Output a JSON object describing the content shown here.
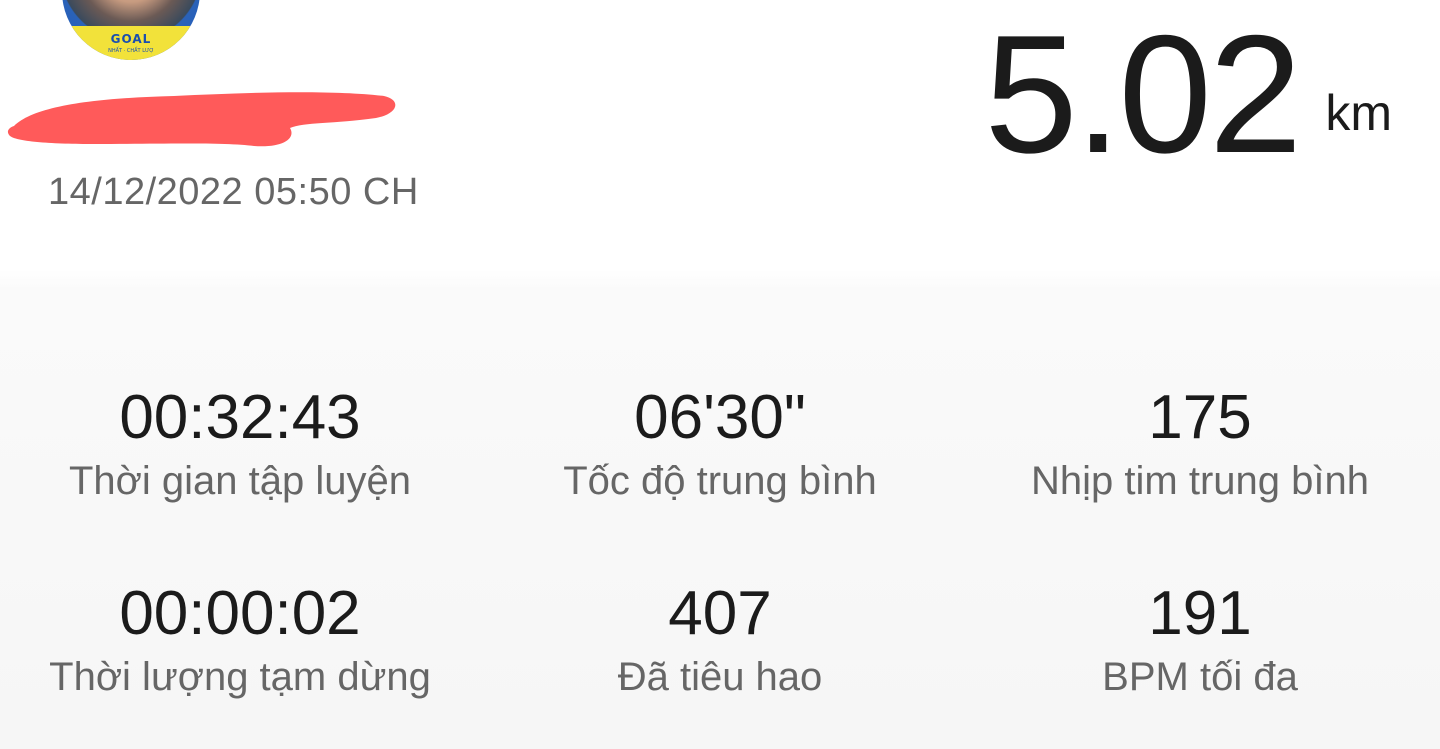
{
  "user": {
    "avatar_icon": "profile-avatar",
    "avatar_badge_text": "GOAL",
    "avatar_badge_subtext": "NHẤT · CHẤT LƯỢ"
  },
  "workout": {
    "datetime": "14/12/2022 05:50 CH",
    "distance_value": "5.02",
    "distance_unit": "km"
  },
  "stats": [
    {
      "value": "00:32:43",
      "label": "Thời gian tập luyện"
    },
    {
      "value": "06'30\"",
      "label": "Tốc độ trung bình"
    },
    {
      "value": "175",
      "label": "Nhịp tim trung bình"
    },
    {
      "value": "00:00:02",
      "label": "Thời lượng tạm dừng"
    },
    {
      "value": "407",
      "label": "Đã tiêu hao"
    },
    {
      "value": "191",
      "label": "BPM tối đa"
    }
  ],
  "colors": {
    "text_primary": "#1b1b1b",
    "text_secondary": "#666666",
    "redaction": "#ff5a5a"
  }
}
